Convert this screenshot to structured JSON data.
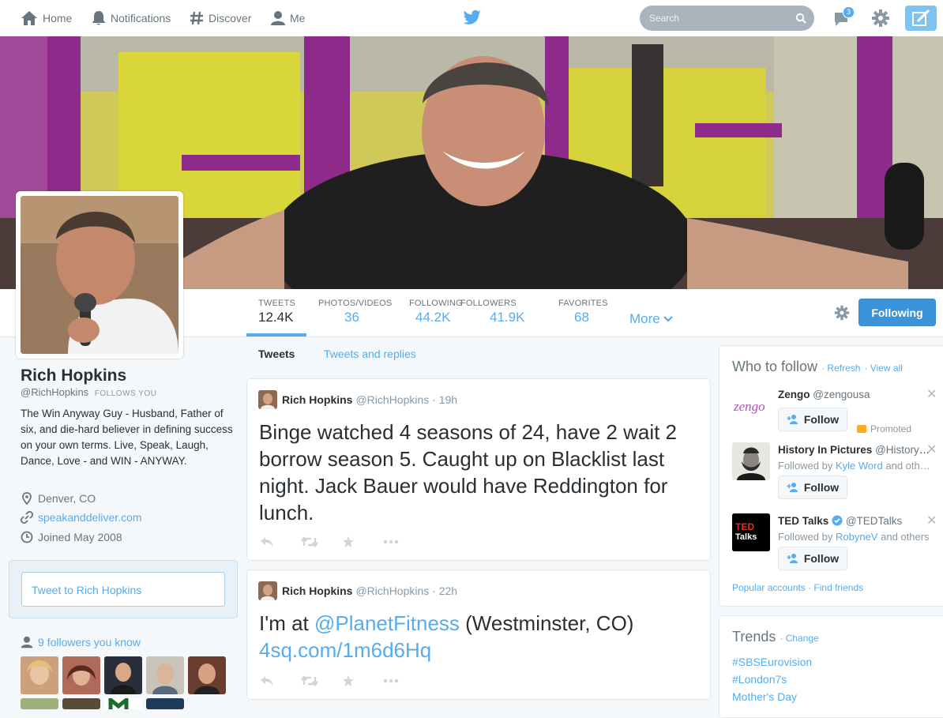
{
  "nav": {
    "home": "Home",
    "notifications": "Notifications",
    "discover": "Discover",
    "me": "Me",
    "search_placeholder": "Search",
    "dm_badge": "3"
  },
  "profile": {
    "name": "Rich Hopkins",
    "handle": "@RichHopkins",
    "follows_you": "FOLLOWS YOU",
    "bio": "The Win Anyway Guy - Husband, Father of six, and die-hard believer in defining success on your own terms. Live, Speak, Laugh, Dance, Love - and WIN - ANYWAY.",
    "location": "Denver, CO",
    "website": "speakanddeliver.com",
    "joined": "Joined May 2008",
    "tweet_to": "Tweet to Rich Hopkins",
    "followers_you_know": "9 followers you know"
  },
  "stats": [
    {
      "label": "TWEETS",
      "value": "12.4K"
    },
    {
      "label": "PHOTOS/VIDEOS",
      "value": "36"
    },
    {
      "label": "FOLLOWING",
      "value": "44.2K"
    },
    {
      "label": "FOLLOWERS",
      "value": "41.9K"
    },
    {
      "label": "FAVORITES",
      "value": "68"
    }
  ],
  "more_label": "More",
  "following_button": "Following",
  "timeline": {
    "tab_tweets": "Tweets",
    "tab_replies": "Tweets and replies",
    "tweets": [
      {
        "name": "Rich Hopkins",
        "handle": "@RichHopkins",
        "time": "19h",
        "text": "Binge watched 4 seasons of 24, have 2 wait 2 borrow season 5. Caught up on Blacklist last night. Jack Bauer would have Reddington for lunch."
      },
      {
        "name": "Rich Hopkins",
        "handle": "@RichHopkins",
        "time": "22h",
        "text_pre": "I'm at ",
        "mention": "@PlanetFitness",
        "text_mid": " (Westminster, CO)",
        "link": "4sq.com/1m6d6Hq"
      }
    ]
  },
  "who_to_follow": {
    "title": "Who to follow",
    "refresh": "Refresh",
    "view_all": "View all",
    "follow_label": "Follow",
    "promoted": "Promoted",
    "items": [
      {
        "name": "Zengo",
        "handle": "@zengousa",
        "logo_text": "zengo"
      },
      {
        "name": "History In Pictures",
        "handle": "@HistoryInPics",
        "followed_by_prefix": "Followed by",
        "followed_by_user": "Kyle Word",
        "followed_by_suffix": "and others"
      },
      {
        "name": "TED Talks",
        "handle": "@TEDTalks",
        "followed_by_prefix": "Followed by",
        "followed_by_user": "RobyneV",
        "followed_by_suffix": "and others",
        "logo_line1": "TED",
        "logo_line2": "Talks"
      }
    ],
    "popular_accounts": "Popular accounts",
    "find_friends": "Find friends"
  },
  "trends": {
    "title": "Trends",
    "change": "Change",
    "items": [
      "#SBSEurovision",
      "#London7s",
      "Mother's Day"
    ]
  },
  "colors": {
    "accent": "#55acee",
    "following_button": "#3b94d9",
    "gym_purple": "#8e2a8a",
    "gym_yellow": "#d9d63a"
  }
}
